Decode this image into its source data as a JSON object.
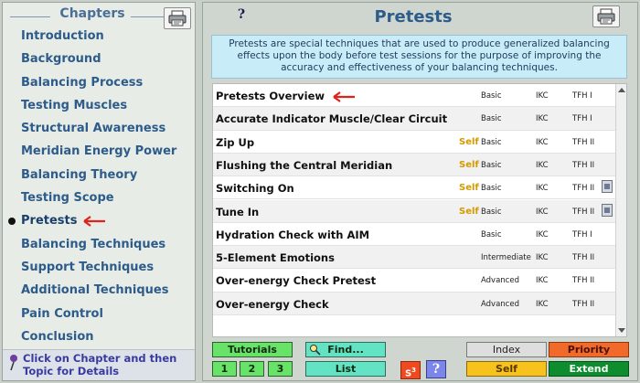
{
  "sidebar": {
    "title": "Chapters",
    "chapters": [
      {
        "label": "Introduction"
      },
      {
        "label": "Background"
      },
      {
        "label": "Balancing Process"
      },
      {
        "label": "Testing Muscles"
      },
      {
        "label": "Structural Awareness"
      },
      {
        "label": "Meridian Energy Power"
      },
      {
        "label": "Balancing Theory"
      },
      {
        "label": "Testing Scope"
      },
      {
        "label": "Pretests"
      },
      {
        "label": "Balancing Techniques"
      },
      {
        "label": "Support Techniques"
      },
      {
        "label": "Additional Techniques"
      },
      {
        "label": "Pain Control"
      },
      {
        "label": "Conclusion"
      }
    ],
    "active_chapter": "Pretests",
    "footer": "Click on Chapter and then Topic for Details"
  },
  "main": {
    "help": "?",
    "title": "Pretests",
    "description": "Pretests are special techniques that are used to produce generalized balancing effects upon the body before test sessions for the purpose of improving the accuracy and effectiveness of your balancing techniques.",
    "topics": [
      {
        "name": "Pretests Overview",
        "self": "",
        "level": "Basic",
        "ikc": "IKC",
        "tfh": "TFH I",
        "video": false
      },
      {
        "name": "Accurate Indicator Muscle/Clear Circuit",
        "self": "",
        "level": "Basic",
        "ikc": "IKC",
        "tfh": "TFH I",
        "video": false
      },
      {
        "name": "Zip Up",
        "self": "Self",
        "level": "Basic",
        "ikc": "IKC",
        "tfh": "TFH II",
        "video": false
      },
      {
        "name": "Flushing the Central Meridian",
        "self": "Self",
        "level": "Basic",
        "ikc": "IKC",
        "tfh": "TFH II",
        "video": false
      },
      {
        "name": "Switching On",
        "self": "Self",
        "level": "Basic",
        "ikc": "IKC",
        "tfh": "TFH II",
        "video": true
      },
      {
        "name": "Tune In",
        "self": "Self",
        "level": "Basic",
        "ikc": "IKC",
        "tfh": "TFH II",
        "video": true
      },
      {
        "name": "Hydration Check with AIM",
        "self": "",
        "level": "Basic",
        "ikc": "IKC",
        "tfh": "TFH I",
        "video": false
      },
      {
        "name": "5-Element Emotions",
        "self": "",
        "level": "Intermediate",
        "ikc": "IKC",
        "tfh": "TFH II",
        "video": false
      },
      {
        "name": "Over-energy Check Pretest",
        "self": "",
        "level": "Advanced",
        "ikc": "IKC",
        "tfh": "TFH II",
        "video": false
      },
      {
        "name": "Over-energy Check",
        "self": "",
        "level": "Advanced",
        "ikc": "IKC",
        "tfh": "TFH II",
        "video": false
      }
    ]
  },
  "buttons": {
    "tutorials": "Tutorials",
    "tutorial_pages": [
      "1",
      "2",
      "3"
    ],
    "find": "Find...",
    "list": "List",
    "s3": "S",
    "s3_sup": "3",
    "question": "?",
    "index": "Index",
    "priority": "Priority",
    "self": "Self",
    "extend": "Extend"
  },
  "colors": {
    "chapter_text": "#2d5b8a",
    "arrow": "#e0221c",
    "self_tag": "#d39a00",
    "description_bg": "#c9ecf9"
  },
  "icons": {
    "printer": "printer-icon",
    "arrow": "red-left-arrow-icon",
    "pin": "pushpin-icon",
    "magnifier": "magnifier-icon",
    "video": "video-clip-icon"
  }
}
